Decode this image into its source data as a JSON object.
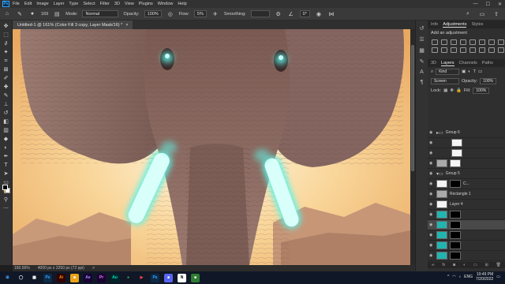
{
  "menu": {
    "app_logo": "Ps",
    "items": [
      "File",
      "Edit",
      "Image",
      "Layer",
      "Type",
      "Select",
      "Filter",
      "3D",
      "View",
      "Plugins",
      "Window",
      "Help"
    ],
    "window_controls": [
      "—",
      "☐",
      "✕"
    ]
  },
  "options": {
    "brush_size": "169",
    "mode_label": "Mode:",
    "mode_value": "Normal",
    "opacity_label": "Opacity:",
    "opacity_value": "100%",
    "flow_label": "Flow:",
    "flow_value": "5%",
    "smoothing_label": "Smoothing:",
    "smoothing_value": "",
    "angle_value": "0°"
  },
  "document": {
    "tab_title": "Untitled-1 @ 161% (Color Fill 3 copy, Layer Mask/16) *",
    "close_glyph": "×"
  },
  "status": {
    "zoom": "160.56%",
    "dimensions": "4000 px x 2250 px (72 ppi)",
    "arrow": ">"
  },
  "panels": {
    "top_tabs": [
      "Info",
      "Adjustments",
      "Styles"
    ],
    "adjustments_title": "Add an adjustment",
    "layer_tabs": [
      "3D",
      "Layers",
      "Channels",
      "Paths"
    ],
    "kind_label": "Kind",
    "blend_mode": "Screen",
    "opacity_label": "Opacity:",
    "opacity_value": "100%",
    "lock_label": "Lock:",
    "fill_label": "Fill:",
    "fill_value": "100%",
    "layers": [
      {
        "name": "Group 6",
        "type": "group"
      },
      {
        "name": "",
        "type": "pair"
      },
      {
        "name": "",
        "type": "pair"
      },
      {
        "name": "",
        "type": "mask"
      },
      {
        "name": "Group 5",
        "type": "group"
      },
      {
        "name": "C...",
        "type": "layer"
      },
      {
        "name": "Rectangle 1",
        "type": "layer"
      },
      {
        "name": "Layer 4",
        "type": "layer"
      },
      {
        "name": "",
        "type": "pair"
      },
      {
        "name": "",
        "type": "pair-selected"
      },
      {
        "name": "",
        "type": "pair"
      },
      {
        "name": "",
        "type": "pair"
      },
      {
        "name": "",
        "type": "pair"
      }
    ]
  },
  "taskbar": {
    "apps": [
      "⊞",
      "◯",
      "▦",
      "Ps",
      "Ai",
      "■",
      "Ae",
      "Pr",
      "Au",
      "●",
      "▶",
      "Ps",
      "■",
      "N",
      "■"
    ],
    "lang": "ENG",
    "time": "10:49 PM",
    "date": "7/20/2022"
  },
  "colors": {
    "accent": "#31a8ff",
    "glow": "#5ff3e6",
    "sky": "#f6c27c"
  }
}
